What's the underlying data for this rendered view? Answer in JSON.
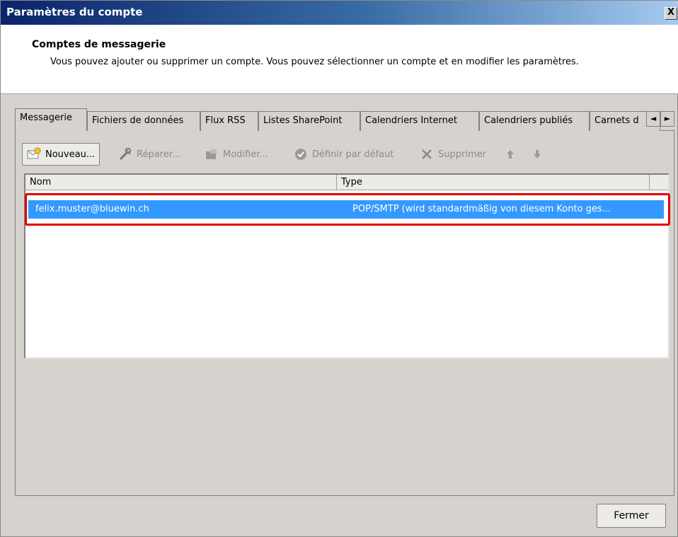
{
  "window": {
    "title": "Paramètres du compte",
    "close_glyph": "X"
  },
  "header": {
    "title": "Comptes de messagerie",
    "description": "Vous pouvez ajouter ou supprimer un compte. Vous pouvez sélectionner un compte et en modifier les paramètres."
  },
  "tabs": [
    {
      "label": "Messagerie",
      "active": true
    },
    {
      "label": "Fichiers de données",
      "active": false
    },
    {
      "label": "Flux RSS",
      "active": false
    },
    {
      "label": "Listes SharePoint",
      "active": false
    },
    {
      "label": "Calendriers Internet",
      "active": false
    },
    {
      "label": "Calendriers publiés",
      "active": false
    },
    {
      "label": "Carnets d",
      "active": false
    }
  ],
  "tab_scroll": {
    "left": "◄",
    "right": "►"
  },
  "toolbar": {
    "new_label": "Nouveau...",
    "repair_label": "Réparer...",
    "modify_label": "Modifier...",
    "default_label": "Définir par défaut",
    "delete_label": "Supprimer",
    "up_icon": "arrow-up-icon",
    "down_icon": "arrow-down-icon"
  },
  "list": {
    "columns": [
      "Nom",
      "Type"
    ],
    "rows": [
      {
        "name": "felix.muster@bluewin.ch",
        "type": "POP/SMTP (wird standardmäßig von diesem Konto ges..."
      }
    ]
  },
  "footer": {
    "close_label": "Fermer"
  },
  "colors": {
    "selection": "#3399ff",
    "highlight_border": "#e00000",
    "dialog_bg": "#d6d3ce"
  }
}
